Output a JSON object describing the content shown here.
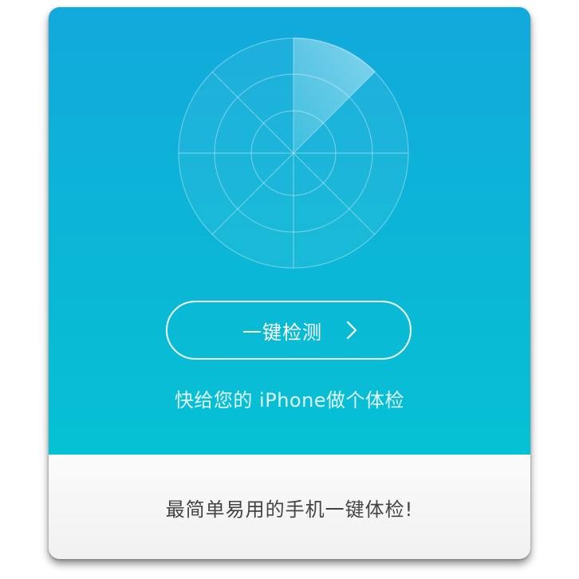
{
  "hero": {
    "scan_button_label": "一键检测",
    "tagline": "快给您的 iPhone做个体检"
  },
  "footer": {
    "text": "最简单易用的手机一键体检!"
  },
  "icons": {
    "radar": "radar-icon",
    "chevron": "chevron-right-icon"
  },
  "colors": {
    "hero_top": "#12a9dc",
    "hero_bottom": "#06c1d4",
    "footer_bg": "#f5f5f5",
    "footer_text": "#444444"
  }
}
